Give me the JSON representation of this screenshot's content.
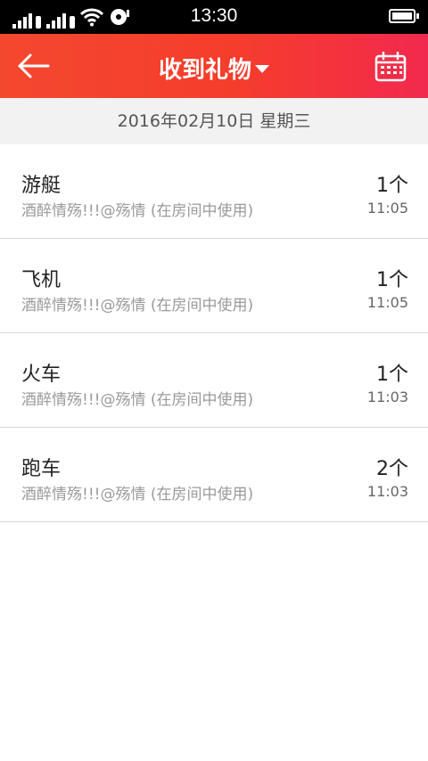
{
  "status_bar": {
    "time": "13:30",
    "sim1": "1",
    "sim2": "2",
    "icons": [
      "signal-icon",
      "signal-icon",
      "wifi-icon",
      "media-icon",
      "battery-icon"
    ]
  },
  "header": {
    "title": "收到礼物",
    "back_icon": "back-arrow-icon",
    "calendar_icon": "calendar-icon",
    "accent_color": "#f4432c"
  },
  "date_label": "2016年02月10日 星期三",
  "gifts": [
    {
      "name": "游艇",
      "from": "酒醉情殇!!!@殇情 (在房间中使用)",
      "count": "1个",
      "time": "11:05"
    },
    {
      "name": "飞机",
      "from": "酒醉情殇!!!@殇情 (在房间中使用)",
      "count": "1个",
      "time": "11:05"
    },
    {
      "name": "火车",
      "from": "酒醉情殇!!!@殇情 (在房间中使用)",
      "count": "1个",
      "time": "11:03"
    },
    {
      "name": "跑车",
      "from": "酒醉情殇!!!@殇情 (在房间中使用)",
      "count": "2个",
      "time": "11:03"
    }
  ]
}
